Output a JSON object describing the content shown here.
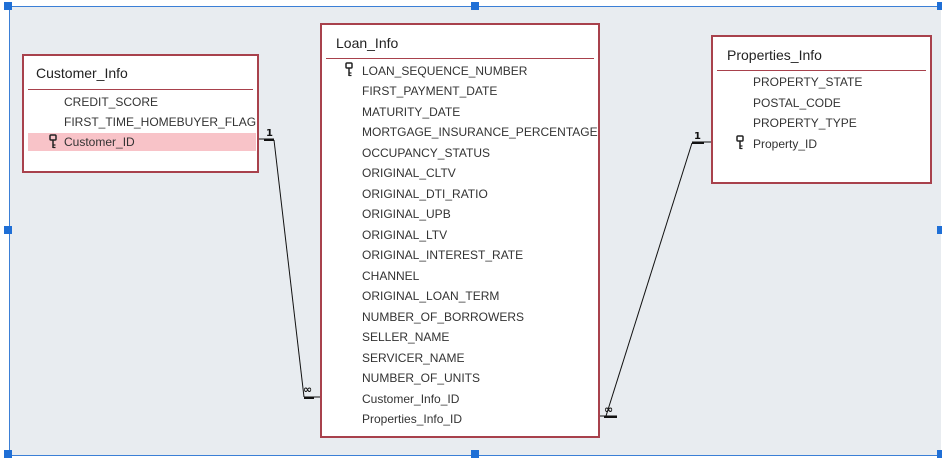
{
  "tables": {
    "customer": {
      "title": "Customer_Info",
      "fields": [
        "CREDIT_SCORE",
        "FIRST_TIME_HOMEBUYER_FLAG",
        "Customer_ID"
      ]
    },
    "loan": {
      "title": "Loan_Info",
      "fields": [
        "LOAN_SEQUENCE_NUMBER",
        "FIRST_PAYMENT_DATE",
        "MATURITY_DATE",
        "MORTGAGE_INSURANCE_PERCENTAGE",
        "OCCUPANCY_STATUS",
        "ORIGINAL_CLTV",
        "ORIGINAL_DTI_RATIO",
        "ORIGINAL_UPB",
        "ORIGINAL_LTV",
        "ORIGINAL_INTEREST_RATE",
        "CHANNEL",
        "ORIGINAL_LOAN_TERM",
        "NUMBER_OF_BORROWERS",
        "SELLER_NAME",
        "SERVICER_NAME",
        "NUMBER_OF_UNITS",
        "Customer_Info_ID",
        "Properties_Info_ID"
      ]
    },
    "properties": {
      "title": "Properties_Info",
      "fields": [
        "PROPERTY_STATE",
        "POSTAL_CODE",
        "PROPERTY_TYPE",
        "Property_ID"
      ]
    }
  },
  "relationships": {
    "customer_loan": {
      "one": "1",
      "many": "∞"
    },
    "properties_loan": {
      "one": "1",
      "many": "∞"
    }
  },
  "colors": {
    "table_border": "#a8414c",
    "selected_row": "#f8c3c8",
    "canvas": "#e8ecf0",
    "selection_frame": "#3b7fd6"
  },
  "icons": {
    "primary_key": "key-icon"
  }
}
